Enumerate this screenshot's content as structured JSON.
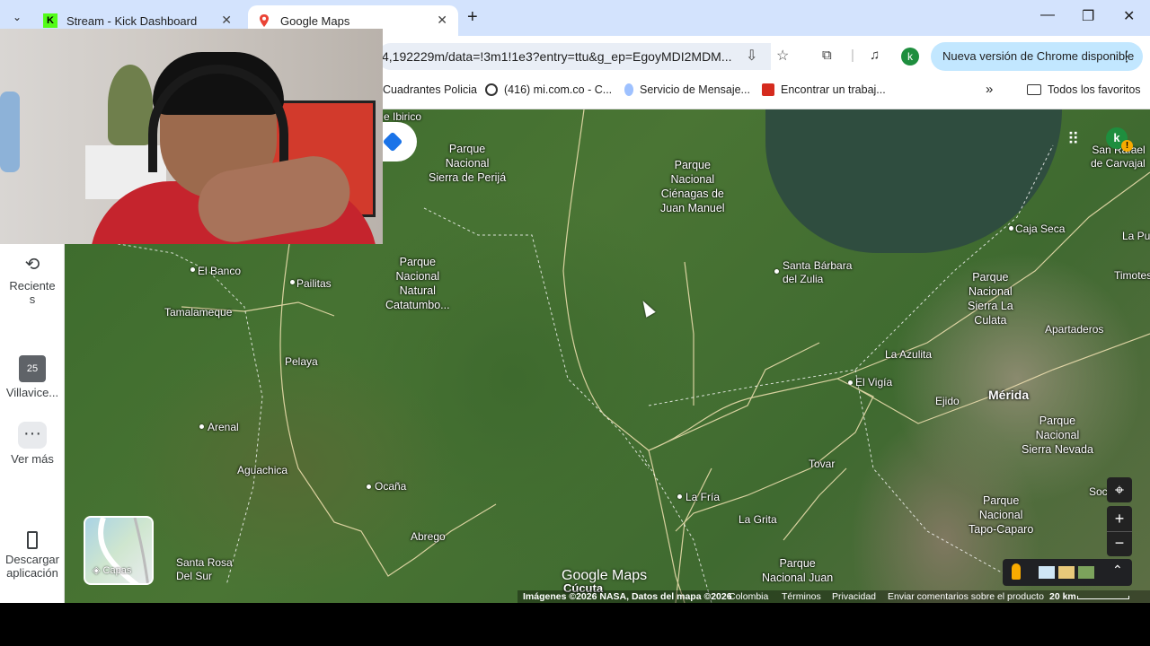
{
  "browser": {
    "tabs": [
      {
        "title": "Stream - Kick Dashboard",
        "icon": "kick-icon"
      },
      {
        "title": "Google Maps",
        "icon": "google-maps-icon"
      }
    ],
    "url": "4,192229m/data=!3m1!1e3?entry=ttu&g_ep=EgoyMDI2MDM...",
    "profile_letter": "k",
    "update_label": "Nueva versión de Chrome disponible",
    "bookmarks": [
      "Cuadrantes Policia",
      "(416) mi.com.co - C...",
      "Servicio de Mensaje...",
      "Encontrar un trabaj..."
    ],
    "all_bookmarks": "Todos los favoritos"
  },
  "sidebar": {
    "recent_l1": "Reciente",
    "recent_l2": "s",
    "saved_label": "Villavice...",
    "calendar_number": "25",
    "more_label": "Ver más",
    "download_l1": "Descargar",
    "download_l2": "aplicación"
  },
  "map": {
    "parks": [
      {
        "l1": "Parque",
        "l2": "Nacional",
        "l3": "Sierra de Perijá"
      },
      {
        "l1": "Parque",
        "l2": "Nacional",
        "l3": "Ciénagas de",
        "l4": "Juan Manuel"
      },
      {
        "l1": "Parque",
        "l2": "Nacional",
        "l3": "Natural",
        "l4": "Catatumbo..."
      },
      {
        "l1": "Parque",
        "l2": "Nacional",
        "l3": "Sierra La",
        "l4": "Culata"
      },
      {
        "l1": "Parque",
        "l2": "Nacional",
        "l3": "Sierra Nevada"
      },
      {
        "l1": "Parque",
        "l2": "Nacional",
        "l3": "Tapo-Caparo"
      },
      {
        "l1": "Parque",
        "l2": "Nacional Juan"
      }
    ],
    "places": {
      "ibirico": "e Ibirico",
      "el_banco": "El Banco",
      "pailitas": "Pailitas",
      "tamalameque": "Tamalameque",
      "pelaya": "Pelaya",
      "arenal": "Arenal",
      "aguachica": "Aguachica",
      "ocana": "Ocaña",
      "abrego": "Abrego",
      "santa_rosa_l1": "Santa Rosa",
      "santa_rosa_l2": "Del Sur",
      "santa_barbara_l1": "Santa Bárbara",
      "santa_barbara_l2": "del Zulia",
      "caja_seca": "Caja Seca",
      "la_pu": "La Pu",
      "timotes": "Timotes",
      "san_rafael_l1": "San Rafael",
      "san_rafael_l2": "de Carvajal",
      "apartaderos": "Apartaderos",
      "la_azulita": "La Azulita",
      "el_vigia": "El Vigía",
      "ejido": "Ejido",
      "merida": "Mérida",
      "tovar": "Tovar",
      "la_fria": "La Fría",
      "la_grita": "La Grita",
      "cucuta": "Cúcuta",
      "soc": "Soc"
    },
    "layers_label": "Capas",
    "logo": "Google Maps",
    "attribution": "Imágenes ©2026 NASA, Datos del mapa ©2026",
    "country": "Colombia",
    "terms": "Términos",
    "privacy": "Privacidad",
    "feedback": "Enviar comentarios sobre el producto",
    "scale": "20 km"
  }
}
